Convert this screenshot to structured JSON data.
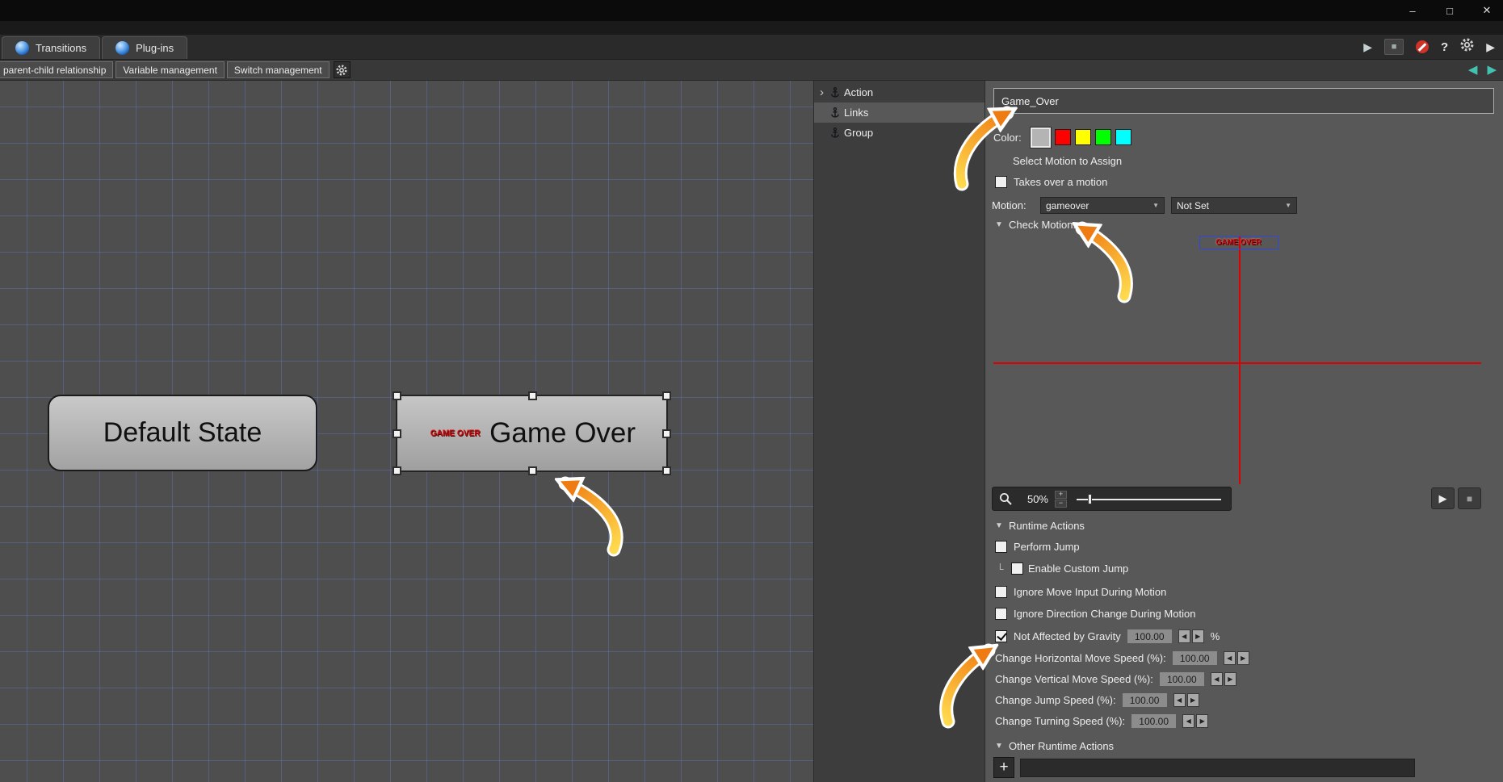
{
  "titlebar": {
    "minimize": "–",
    "maximize": "□",
    "close": "✕"
  },
  "icons": {
    "play": "▶",
    "stop": "■",
    "help": "?",
    "step": "▶",
    "back": "◀",
    "forward": "▶",
    "expand": "›",
    "caret": "▼",
    "section": "▼",
    "plus": "+",
    "minus": "−",
    "spin_left": "◀",
    "spin_right": "▶",
    "tree_corner": "└"
  },
  "toolbar": {
    "tabs": [
      {
        "label": "Transitions"
      },
      {
        "label": "Plug-ins"
      }
    ]
  },
  "managebar": {
    "tabs": [
      {
        "label": "parent-child relationship"
      },
      {
        "label": "Variable management"
      },
      {
        "label": "Switch management"
      }
    ]
  },
  "outline": {
    "items": [
      {
        "label": "Action"
      },
      {
        "label": "Links"
      },
      {
        "label": "Group"
      }
    ],
    "selected_index": 1
  },
  "canvas": {
    "nodes": [
      {
        "label": "Default State"
      },
      {
        "label": "Game Over",
        "selected": true
      }
    ],
    "sprite_text": "GAME OVER"
  },
  "props": {
    "name": "Game_Over",
    "color_label": "Color:",
    "colors": [
      "#b4b4b4",
      "#ff0000",
      "#ffff00",
      "#00ff00",
      "#00ffff"
    ],
    "selected_color_index": 0,
    "select_motion_label": "Select Motion to Assign",
    "takes_over_label": "Takes over a motion",
    "motion_label": "Motion:",
    "motion_value": "gameover",
    "motion_value2": "Not Set",
    "check_motion_label": "Check Motion:",
    "zoom_value": "50%",
    "runtime_label": "Runtime Actions",
    "checks": [
      {
        "label": "Perform Jump",
        "checked": false
      },
      {
        "label": "Enable Custom Jump",
        "checked": false
      },
      {
        "label": "Ignore Move Input During Motion",
        "checked": false
      },
      {
        "label": "Ignore Direction Change During Motion",
        "checked": false
      },
      {
        "label": "Not Affected by Gravity",
        "checked": true,
        "value": "100.00",
        "suffix": "%"
      }
    ],
    "speeds": [
      {
        "label": "Change Horizontal Move Speed (%):",
        "value": "100.00"
      },
      {
        "label": "Change Vertical Move Speed (%):",
        "value": "100.00"
      },
      {
        "label": "Change Jump Speed (%):",
        "value": "100.00"
      },
      {
        "label": "Change Turning Speed (%):",
        "value": "100.00"
      }
    ],
    "other_runtime_label": "Other Runtime Actions"
  }
}
